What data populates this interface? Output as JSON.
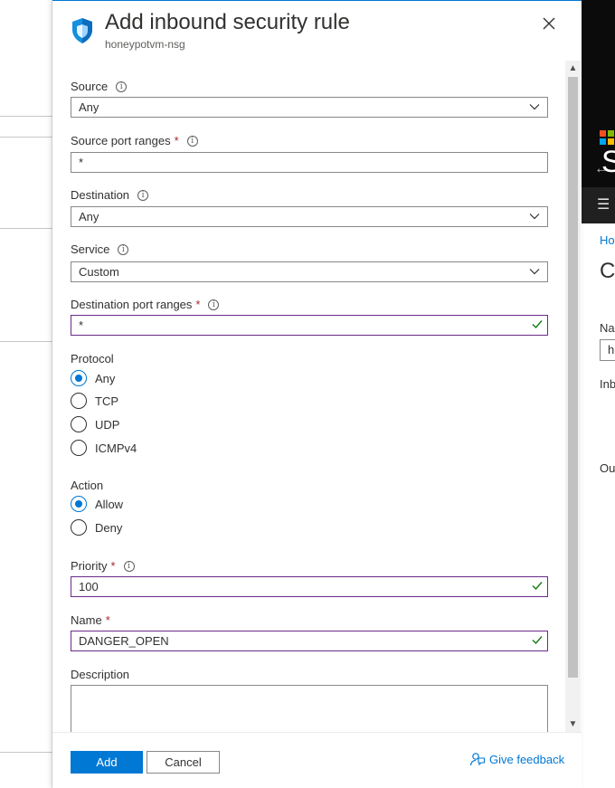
{
  "panel": {
    "title": "Add inbound security rule",
    "subtitle": "honeypotvm-nsg"
  },
  "form": {
    "source": {
      "label": "Source",
      "value": "Any"
    },
    "source_port_ranges": {
      "label": "Source port ranges",
      "value": "*"
    },
    "destination": {
      "label": "Destination",
      "value": "Any"
    },
    "service": {
      "label": "Service",
      "value": "Custom"
    },
    "destination_port_ranges": {
      "label": "Destination port ranges",
      "value": "*"
    },
    "protocol": {
      "label": "Protocol",
      "options": [
        "Any",
        "TCP",
        "UDP",
        "ICMPv4"
      ],
      "selected": "Any"
    },
    "action": {
      "label": "Action",
      "options": [
        "Allow",
        "Deny"
      ],
      "selected": "Allow"
    },
    "priority": {
      "label": "Priority",
      "value": "100"
    },
    "name": {
      "label": "Name",
      "value": "DANGER_OPEN"
    },
    "description": {
      "label": "Description",
      "value": ""
    }
  },
  "footer": {
    "add_label": "Add",
    "cancel_label": "Cancel",
    "feedback_label": "Give feedback"
  },
  "background_right": {
    "title_fragment": "S",
    "breadcrumb_fragment": "Ho",
    "heading_fragment": "Cr",
    "name_label_fragment": "Na",
    "name_input_fragment": "h",
    "inbound_fragment": "Inb",
    "outbound_fragment": "Ou"
  },
  "colors": {
    "accent": "#0078d4",
    "valid_border": "#6b2a8a",
    "valid_check": "#107c10",
    "required": "#a4262c"
  },
  "icons": {
    "panel_icon": "shield-icon",
    "close": "close-icon",
    "dropdown": "chevron-down-icon",
    "valid": "checkmark-icon",
    "info": "info-icon",
    "feedback": "feedback-icon"
  }
}
